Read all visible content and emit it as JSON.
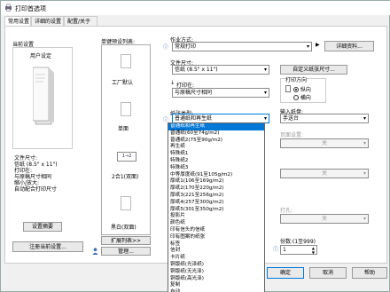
{
  "window": {
    "title": "打印首选项"
  },
  "tabs": [
    {
      "label": "常用设置"
    },
    {
      "label": "详细的设置"
    },
    {
      "label": "配置/关于"
    }
  ],
  "left": {
    "current_setting_label": "当前设置",
    "user_setting_label": "用户设定",
    "summary_lines": [
      "文件尺寸:",
      "信纸 (8.5\" x 11\")",
      "打印在:",
      "与原稿尺寸相同",
      "缩小/放大:",
      "  自动配合打印尺寸"
    ],
    "setting_summary_button": "设置摘要",
    "register_button": "注册当前设置..."
  },
  "presets": {
    "label": "单键预设列表:",
    "items": [
      {
        "label": "工厂默认"
      },
      {
        "label": "单面"
      },
      {
        "label": "2合1(双面)",
        "badge": "1→2"
      },
      {
        "label": "黑白(双面)"
      }
    ],
    "expand_button": "扩展列表>>",
    "manage_button": "管理..."
  },
  "job": {
    "label": "作业方式:",
    "value": "常规打印",
    "details_button": "详细资料..."
  },
  "doc_size": {
    "label": "文件尺寸:",
    "value": "信纸 (8.5\" x 11\")",
    "custom_button": "自定义纸张尺寸..."
  },
  "print_on": {
    "label": "打印在:",
    "value": "与原稿尺寸相同"
  },
  "orientation": {
    "label": "打印方向",
    "options": [
      "纵向",
      "横向"
    ],
    "selected": 0
  },
  "paper_type": {
    "label": "纸张类型:",
    "value": "普通纸和再生纸",
    "options": [
      "普通纸和再生纸",
      "普通纸(60至74g/m2)",
      "普通纸2(75至90g/m2)",
      "再生纸",
      "特殊纸1",
      "特殊纸2",
      "特殊纸3",
      "中等厚度纸(91至105g/m2)",
      "厚纸1(106至169g/m2)",
      "厚纸2(170至220g/m2)",
      "厚纸3(221至256g/m2)",
      "厚纸4(257至300g/m2)",
      "厚纸5(301至350g/m2)",
      "投影片",
      "颜色纸",
      "印有信头的信纸",
      "印有图案的纸张",
      "标签",
      "信封",
      "卡片纸",
      "铜版纸(光泽纸)",
      "铜版纸(无光泽)",
      "铜版纸(高光泽)",
      "复制",
      "自动"
    ]
  },
  "input_tray": {
    "label": "输入纸盘:",
    "value": "手送台"
  },
  "two_sided": {
    "label": "页面设置:",
    "value": "关"
  },
  "staple": {
    "value": "关"
  },
  "punch": {
    "label": "打孔:",
    "value": "关"
  },
  "copies": {
    "label": "份数:(1至999)",
    "value": "1"
  },
  "footer": {
    "ok": "确定",
    "cancel": "取消",
    "help": "帮助"
  },
  "colors": {
    "accent": "#0078d7",
    "panel_border": "#cccccc"
  }
}
